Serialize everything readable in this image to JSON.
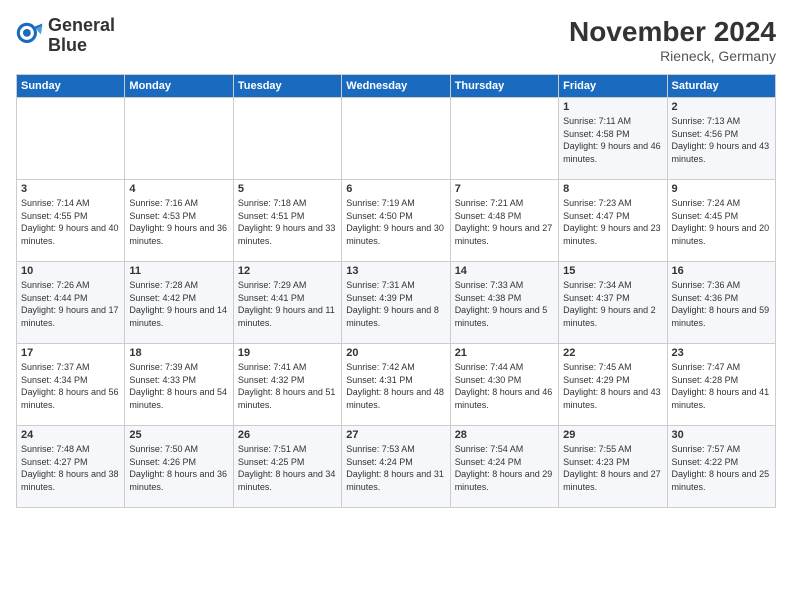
{
  "logo": {
    "line1": "General",
    "line2": "Blue"
  },
  "title": "November 2024",
  "location": "Rieneck, Germany",
  "days_header": [
    "Sunday",
    "Monday",
    "Tuesday",
    "Wednesday",
    "Thursday",
    "Friday",
    "Saturday"
  ],
  "weeks": [
    [
      {
        "num": "",
        "info": ""
      },
      {
        "num": "",
        "info": ""
      },
      {
        "num": "",
        "info": ""
      },
      {
        "num": "",
        "info": ""
      },
      {
        "num": "",
        "info": ""
      },
      {
        "num": "1",
        "info": "Sunrise: 7:11 AM\nSunset: 4:58 PM\nDaylight: 9 hours and 46 minutes."
      },
      {
        "num": "2",
        "info": "Sunrise: 7:13 AM\nSunset: 4:56 PM\nDaylight: 9 hours and 43 minutes."
      }
    ],
    [
      {
        "num": "3",
        "info": "Sunrise: 7:14 AM\nSunset: 4:55 PM\nDaylight: 9 hours and 40 minutes."
      },
      {
        "num": "4",
        "info": "Sunrise: 7:16 AM\nSunset: 4:53 PM\nDaylight: 9 hours and 36 minutes."
      },
      {
        "num": "5",
        "info": "Sunrise: 7:18 AM\nSunset: 4:51 PM\nDaylight: 9 hours and 33 minutes."
      },
      {
        "num": "6",
        "info": "Sunrise: 7:19 AM\nSunset: 4:50 PM\nDaylight: 9 hours and 30 minutes."
      },
      {
        "num": "7",
        "info": "Sunrise: 7:21 AM\nSunset: 4:48 PM\nDaylight: 9 hours and 27 minutes."
      },
      {
        "num": "8",
        "info": "Sunrise: 7:23 AM\nSunset: 4:47 PM\nDaylight: 9 hours and 23 minutes."
      },
      {
        "num": "9",
        "info": "Sunrise: 7:24 AM\nSunset: 4:45 PM\nDaylight: 9 hours and 20 minutes."
      }
    ],
    [
      {
        "num": "10",
        "info": "Sunrise: 7:26 AM\nSunset: 4:44 PM\nDaylight: 9 hours and 17 minutes."
      },
      {
        "num": "11",
        "info": "Sunrise: 7:28 AM\nSunset: 4:42 PM\nDaylight: 9 hours and 14 minutes."
      },
      {
        "num": "12",
        "info": "Sunrise: 7:29 AM\nSunset: 4:41 PM\nDaylight: 9 hours and 11 minutes."
      },
      {
        "num": "13",
        "info": "Sunrise: 7:31 AM\nSunset: 4:39 PM\nDaylight: 9 hours and 8 minutes."
      },
      {
        "num": "14",
        "info": "Sunrise: 7:33 AM\nSunset: 4:38 PM\nDaylight: 9 hours and 5 minutes."
      },
      {
        "num": "15",
        "info": "Sunrise: 7:34 AM\nSunset: 4:37 PM\nDaylight: 9 hours and 2 minutes."
      },
      {
        "num": "16",
        "info": "Sunrise: 7:36 AM\nSunset: 4:36 PM\nDaylight: 8 hours and 59 minutes."
      }
    ],
    [
      {
        "num": "17",
        "info": "Sunrise: 7:37 AM\nSunset: 4:34 PM\nDaylight: 8 hours and 56 minutes."
      },
      {
        "num": "18",
        "info": "Sunrise: 7:39 AM\nSunset: 4:33 PM\nDaylight: 8 hours and 54 minutes."
      },
      {
        "num": "19",
        "info": "Sunrise: 7:41 AM\nSunset: 4:32 PM\nDaylight: 8 hours and 51 minutes."
      },
      {
        "num": "20",
        "info": "Sunrise: 7:42 AM\nSunset: 4:31 PM\nDaylight: 8 hours and 48 minutes."
      },
      {
        "num": "21",
        "info": "Sunrise: 7:44 AM\nSunset: 4:30 PM\nDaylight: 8 hours and 46 minutes."
      },
      {
        "num": "22",
        "info": "Sunrise: 7:45 AM\nSunset: 4:29 PM\nDaylight: 8 hours and 43 minutes."
      },
      {
        "num": "23",
        "info": "Sunrise: 7:47 AM\nSunset: 4:28 PM\nDaylight: 8 hours and 41 minutes."
      }
    ],
    [
      {
        "num": "24",
        "info": "Sunrise: 7:48 AM\nSunset: 4:27 PM\nDaylight: 8 hours and 38 minutes."
      },
      {
        "num": "25",
        "info": "Sunrise: 7:50 AM\nSunset: 4:26 PM\nDaylight: 8 hours and 36 minutes."
      },
      {
        "num": "26",
        "info": "Sunrise: 7:51 AM\nSunset: 4:25 PM\nDaylight: 8 hours and 34 minutes."
      },
      {
        "num": "27",
        "info": "Sunrise: 7:53 AM\nSunset: 4:24 PM\nDaylight: 8 hours and 31 minutes."
      },
      {
        "num": "28",
        "info": "Sunrise: 7:54 AM\nSunset: 4:24 PM\nDaylight: 8 hours and 29 minutes."
      },
      {
        "num": "29",
        "info": "Sunrise: 7:55 AM\nSunset: 4:23 PM\nDaylight: 8 hours and 27 minutes."
      },
      {
        "num": "30",
        "info": "Sunrise: 7:57 AM\nSunset: 4:22 PM\nDaylight: 8 hours and 25 minutes."
      }
    ]
  ]
}
